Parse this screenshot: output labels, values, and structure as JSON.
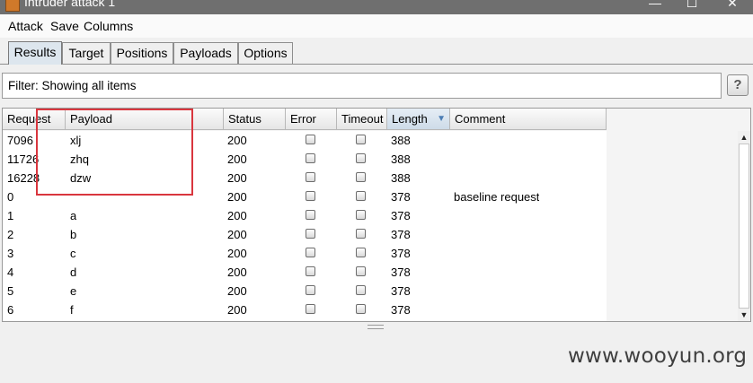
{
  "window": {
    "title": "Intruder attack 1",
    "minimize_glyph": "—",
    "maximize_glyph": "☐",
    "close_glyph": "✕"
  },
  "menu": [
    "Attack",
    "Save",
    "Columns"
  ],
  "tabs": [
    {
      "label": "Results",
      "active": true
    },
    {
      "label": "Target",
      "active": false
    },
    {
      "label": "Positions",
      "active": false
    },
    {
      "label": "Payloads",
      "active": false
    },
    {
      "label": "Options",
      "active": false
    }
  ],
  "filter": {
    "text": "Filter: Showing all items",
    "help_label": "?"
  },
  "table": {
    "columns": [
      "Request",
      "Payload",
      "Status",
      "Error",
      "Timeout",
      "Length",
      "Comment"
    ],
    "sorted_column": "Length",
    "rows": [
      {
        "request": "7096",
        "payload": "xlj",
        "status": "200",
        "error": false,
        "timeout": false,
        "length": "388",
        "comment": ""
      },
      {
        "request": "11726",
        "payload": "zhq",
        "status": "200",
        "error": false,
        "timeout": false,
        "length": "388",
        "comment": ""
      },
      {
        "request": "16228",
        "payload": "dzw",
        "status": "200",
        "error": false,
        "timeout": false,
        "length": "388",
        "comment": ""
      },
      {
        "request": "0",
        "payload": "",
        "status": "200",
        "error": false,
        "timeout": false,
        "length": "378",
        "comment": "baseline request"
      },
      {
        "request": "1",
        "payload": "a",
        "status": "200",
        "error": false,
        "timeout": false,
        "length": "378",
        "comment": ""
      },
      {
        "request": "2",
        "payload": "b",
        "status": "200",
        "error": false,
        "timeout": false,
        "length": "378",
        "comment": ""
      },
      {
        "request": "3",
        "payload": "c",
        "status": "200",
        "error": false,
        "timeout": false,
        "length": "378",
        "comment": ""
      },
      {
        "request": "4",
        "payload": "d",
        "status": "200",
        "error": false,
        "timeout": false,
        "length": "378",
        "comment": ""
      },
      {
        "request": "5",
        "payload": "e",
        "status": "200",
        "error": false,
        "timeout": false,
        "length": "378",
        "comment": ""
      },
      {
        "request": "6",
        "payload": "f",
        "status": "200",
        "error": false,
        "timeout": false,
        "length": "378",
        "comment": ""
      }
    ]
  },
  "watermark": "www.wooyun.org",
  "colors": {
    "annotation": "#d9363e",
    "active_tab": "#dde6ee"
  }
}
